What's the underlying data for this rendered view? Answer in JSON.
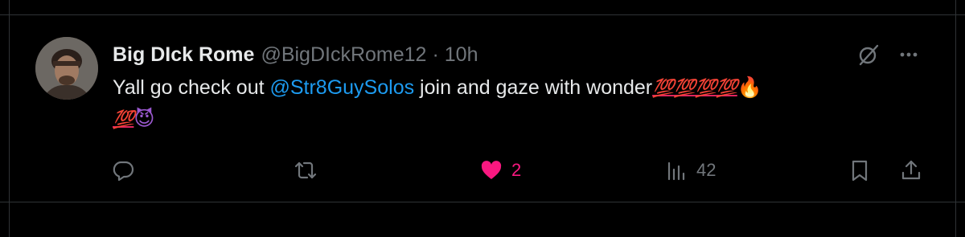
{
  "tweet": {
    "display_name": "Big DIck Rome",
    "handle": "@BigDIckRome12",
    "separator": "·",
    "time": "10h",
    "text_before_mention": "Yall go check out ",
    "mention": "@Str8GuySolos",
    "text_after_mention": " join and gaze with wonder",
    "emoji_hundred": "💯",
    "emoji_fire": "🔥",
    "emoji_devil": "😈"
  },
  "actions": {
    "reply_icon": "reply-icon",
    "retweet_icon": "retweet-icon",
    "like_icon": "heart-filled-icon",
    "like_count": "2",
    "views_icon": "bar-chart-icon",
    "views_count": "42",
    "bookmark_icon": "bookmark-icon",
    "share_icon": "share-icon"
  },
  "colors": {
    "background": "#000000",
    "text": "#e7e9ea",
    "muted": "#71767b",
    "mention": "#1d9bf0",
    "like": "#f91880",
    "divider": "#2f3336"
  }
}
